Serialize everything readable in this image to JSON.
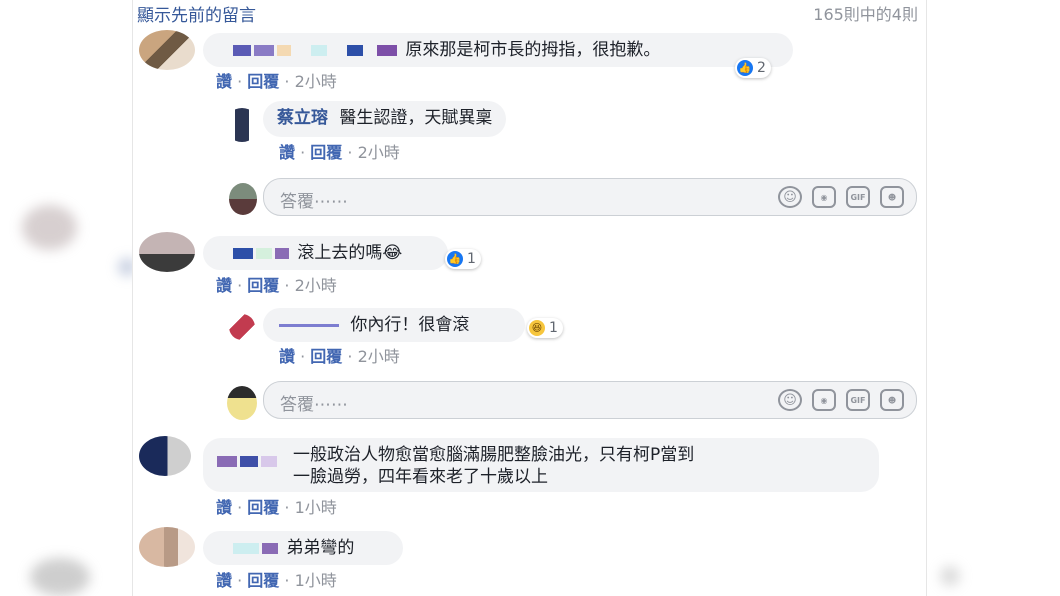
{
  "header": {
    "prev_link": "顯示先前的留言",
    "count": "165則中的4則"
  },
  "comments": [
    {
      "text": "原來那是柯市長的拇指，很抱歉。",
      "like_label": "讚",
      "reply_label": "回覆",
      "time": "2小時",
      "reaction_count": "2"
    },
    {
      "text": "滾上去的嗎😂",
      "like_label": "讚",
      "reply_label": "回覆",
      "time": "2小時",
      "reaction_count": "1"
    },
    {
      "text_line1": "一般政治人物愈當愈腦滿腸肥整臉油光，只有柯P當到",
      "text_line2": "一臉過勞，四年看來老了十歲以上",
      "like_label": "讚",
      "reply_label": "回覆",
      "time": "1小時"
    },
    {
      "text": "弟弟彎的",
      "like_label": "讚",
      "reply_label": "回覆",
      "time": "1小時"
    }
  ],
  "replies": [
    {
      "name": "蔡立瑢",
      "text": "醫生認證，天賦異稟",
      "like_label": "讚",
      "reply_label": "回覆",
      "time": "2小時"
    },
    {
      "text": "你內行！很會滾",
      "like_label": "讚",
      "reply_label": "回覆",
      "time": "2小時",
      "reaction_count": "1"
    }
  ],
  "reply_input": {
    "placeholder": "答覆⋯⋯"
  },
  "icons": [
    "smiley-icon",
    "camera-icon",
    "gif-icon",
    "sticker-icon",
    "like-reaction-icon",
    "haha-reaction-icon"
  ],
  "colors": {
    "link": "#365899",
    "action": "#4267b2",
    "bubble": "#f2f3f5",
    "like_blue": "#1877f2"
  }
}
